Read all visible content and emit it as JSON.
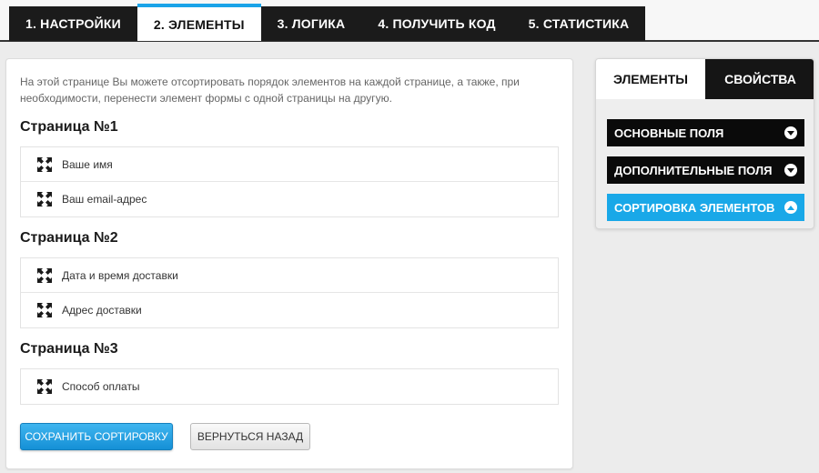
{
  "tabs": [
    {
      "label": "1. Настройки",
      "active": false
    },
    {
      "label": "2. Элементы",
      "active": true
    },
    {
      "label": "3. Логика",
      "active": false
    },
    {
      "label": "4. Получить код",
      "active": false
    },
    {
      "label": "5. Статистика",
      "active": false
    }
  ],
  "main": {
    "intro": "На этой странице Вы можете отсортировать порядок элементов на каждой странице, а также, при необходимости, перенести элемент формы с одной страницы на другую.",
    "pages": [
      {
        "title": "Страница №1",
        "items": [
          "Ваше имя",
          "Ваш email-адрес"
        ]
      },
      {
        "title": "Страница №2",
        "items": [
          "Дата и время доставки",
          "Адрес доставки"
        ]
      },
      {
        "title": "Страница №3",
        "items": [
          "Способ оплаты"
        ]
      }
    ],
    "save_label": "Сохранить сортировку",
    "back_label": "Вернуться назад"
  },
  "sidebar": {
    "tab_elements": "Элементы",
    "tab_properties": "Свойства",
    "sections": [
      {
        "label": "Основные поля",
        "expanded": false
      },
      {
        "label": "Дополнительные поля",
        "expanded": false
      },
      {
        "label": "Сортировка элементов",
        "expanded": true
      }
    ]
  },
  "colors": {
    "accent": "#19a8e8",
    "dark": "#1b1b1b"
  },
  "icons": {
    "drag": "drag-handle-icon",
    "collapsed": "chevron-down-icon",
    "expanded": "chevron-up-icon"
  }
}
